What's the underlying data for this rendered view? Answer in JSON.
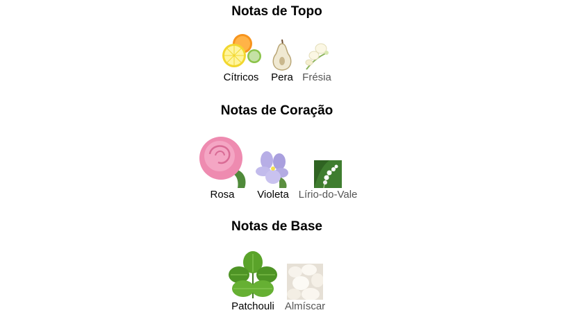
{
  "sections": [
    {
      "title": "Notas de Topo",
      "notes": [
        {
          "label": "Cítricos",
          "icon": "citrus-fruits-icon"
        },
        {
          "label": "Pera",
          "icon": "pear-icon"
        },
        {
          "label": "Frésia",
          "icon": "freesia-icon"
        }
      ]
    },
    {
      "title": "Notas de Coração",
      "notes": [
        {
          "label": "Rosa",
          "icon": "rose-icon"
        },
        {
          "label": "Violeta",
          "icon": "violet-flower-icon"
        },
        {
          "label": "Lírio-do-Vale",
          "icon": "lily-of-the-valley-icon"
        }
      ]
    },
    {
      "title": "Notas de Base",
      "notes": [
        {
          "label": "Patchouli",
          "icon": "patchouli-leaf-icon"
        },
        {
          "label": "Almíscar",
          "icon": "musk-icon"
        }
      ]
    }
  ]
}
